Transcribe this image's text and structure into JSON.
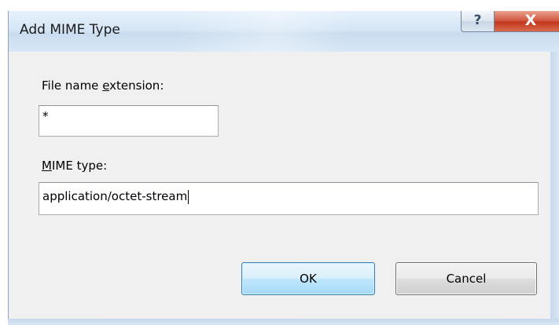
{
  "window": {
    "title": "Add MIME Type",
    "help_glyph": "?",
    "close_glyph": "X"
  },
  "form": {
    "extension_label_pre": "File name ",
    "extension_label_accel": "e",
    "extension_label_post": "xtension:",
    "extension_value": "*",
    "mime_label_accel": "M",
    "mime_label_post": "IME type:",
    "mime_value": "application/octet-stream"
  },
  "buttons": {
    "ok_label": "OK",
    "cancel_label": "Cancel"
  },
  "colors": {
    "titlebar": "#d6e6f6",
    "client_bg": "#f0f0f0",
    "close_button": "#c2371c",
    "default_button_border": "#3c7fb1"
  }
}
